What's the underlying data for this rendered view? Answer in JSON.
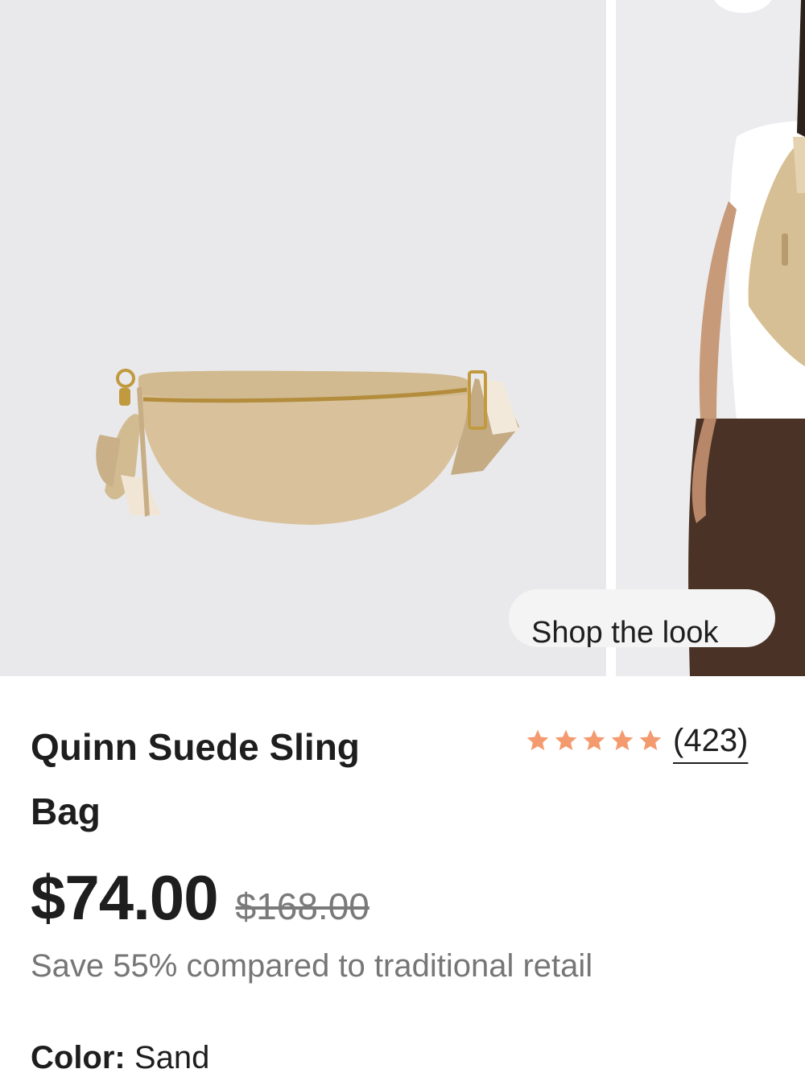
{
  "gallery": {
    "shop_the_look_label": "Shop the look"
  },
  "product": {
    "title_line1": "Quinn Suede Sling",
    "title_line2": "Bag",
    "rating": 5,
    "rating_max": 5,
    "rating_color": "#f39a6e",
    "reviews_count": "(423)",
    "price": "$74.00",
    "original_price": "$168.00",
    "savings_text": "Save 55% compared to traditional retail",
    "color_label": "Color:",
    "color_value": "Sand"
  }
}
